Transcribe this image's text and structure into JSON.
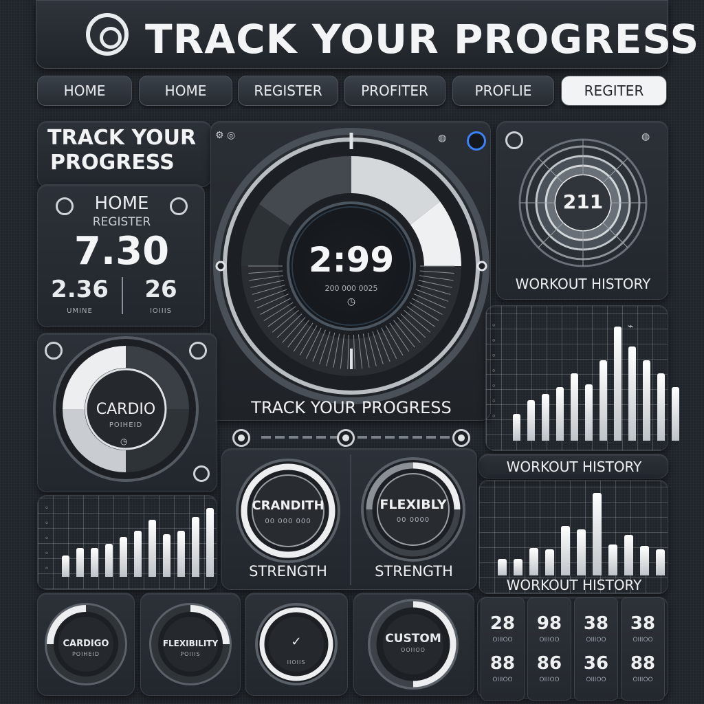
{
  "header": {
    "title": "TRACK YOUR PROGRESS"
  },
  "nav": [
    "HOME",
    "HOME",
    "REGISTER",
    "PROFITER",
    "PROFLIE",
    "REGITER"
  ],
  "summary": {
    "title_line1": "TRACK YOUR",
    "title_line2": "PROGRESS",
    "home_label": "HOME",
    "register_label": "REGISTER",
    "main_value": "7.30",
    "left_value": "2.36",
    "left_caption": "UMINE",
    "right_value": "26",
    "right_caption": "IOIIIS"
  },
  "main_gauge": {
    "value": "2:99",
    "sub_text": "200 000 0025",
    "icon": "stopwatch-icon",
    "caption": "TRACK YOUR PROGRESS"
  },
  "workout_ring": {
    "value": "211",
    "caption": "WORKOUT HISTORY"
  },
  "cardio_dial": {
    "label": "CARDIO",
    "sub": "POIHEID"
  },
  "strength_dials": [
    {
      "label": "CRANDITH",
      "sub": "00 000 000",
      "caption": "STRENGTH"
    },
    {
      "label": "FLEXIBLY",
      "sub": "00 0000",
      "caption": "STRENGTH"
    }
  ],
  "history_headings": [
    "WORKOUT HISTORY",
    "WORKOUT HISTORY"
  ],
  "bottom_dials": [
    {
      "label": "CARDIGO",
      "sub": "POIHEID"
    },
    {
      "label": "FLEXIBILITY",
      "sub": "POIIIS"
    },
    {
      "label": "",
      "sub": "IIOIIS"
    },
    {
      "label": "CUSTOM",
      "sub": "OOIIOO"
    }
  ],
  "stats": [
    {
      "top": "28",
      "bottom": "88"
    },
    {
      "top": "98",
      "bottom": "86"
    },
    {
      "top": "38",
      "bottom": "36"
    },
    {
      "top": "38",
      "bottom": "88"
    }
  ],
  "chart_data": [
    {
      "type": "bar",
      "series": [
        {
          "values": [
            2,
            3,
            3.5,
            4,
            5,
            4.2,
            6,
            8.5,
            7,
            6,
            5,
            4
          ]
        }
      ]
    },
    {
      "type": "bar",
      "series": [
        {
          "values": [
            1.5,
            2,
            2,
            2.3,
            2.8,
            3.2,
            4,
            3,
            3.2,
            4.2,
            4.8
          ]
        }
      ]
    },
    {
      "type": "bar",
      "series": [
        {
          "values": [
            1.5,
            1.5,
            2.5,
            2.4,
            4.5,
            4.2,
            7.5,
            2.8,
            3.7,
            2.7,
            2.4
          ]
        }
      ]
    }
  ],
  "colors": {
    "background": "#20252b",
    "panel": "#2c3138",
    "accent": "#f1f3f4",
    "blue_dot": "#3b82f6"
  }
}
